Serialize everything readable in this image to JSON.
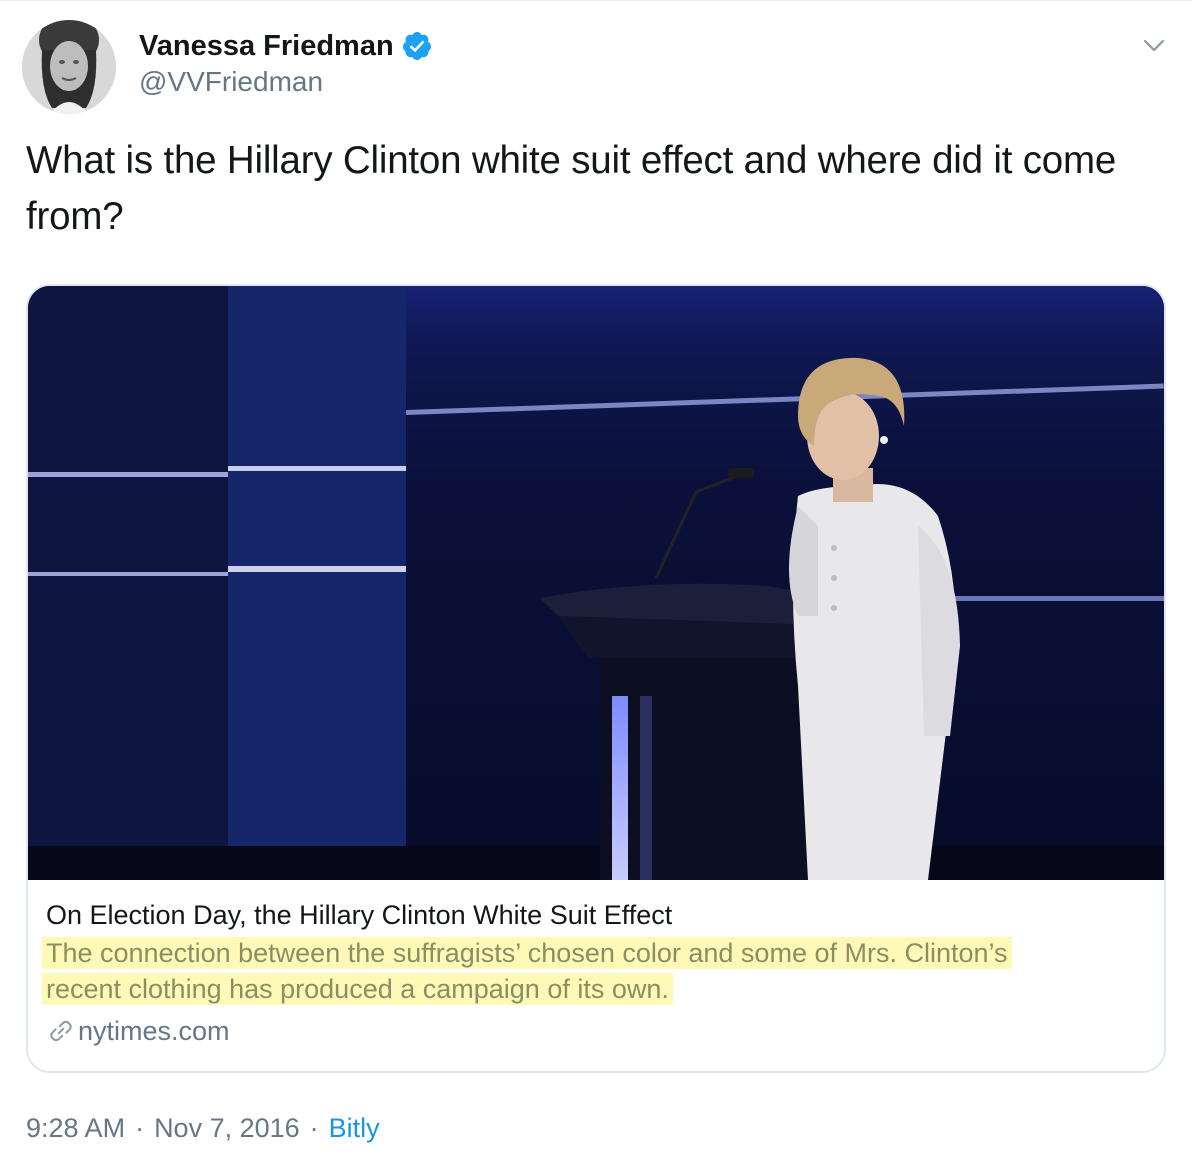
{
  "author": {
    "name": "Vanessa Friedman",
    "handle": "@VVFriedman",
    "verified": true
  },
  "tweet": {
    "text": "What is the Hillary Clinton white suit effect and where did it come from?"
  },
  "card": {
    "title": "On Election Day, the Hillary Clinton White Suit Effect",
    "description_line1": "The connection between the suffragists’ chosen color and some of Mrs. Clinton’s",
    "description_line2": "recent clothing has produced a campaign of its own.",
    "domain": "nytimes.com"
  },
  "meta": {
    "time": "9:28 AM",
    "separator": "·",
    "date": "Nov 7, 2016",
    "source": "Bitly"
  },
  "colors": {
    "verified": "#1da1f2",
    "link": "#1b95e0",
    "secondary_text": "#657786",
    "highlight": "#fff9b8"
  },
  "icons": {
    "verified": "verified-badge-icon",
    "caret": "chevron-down-icon",
    "link": "link-icon"
  }
}
